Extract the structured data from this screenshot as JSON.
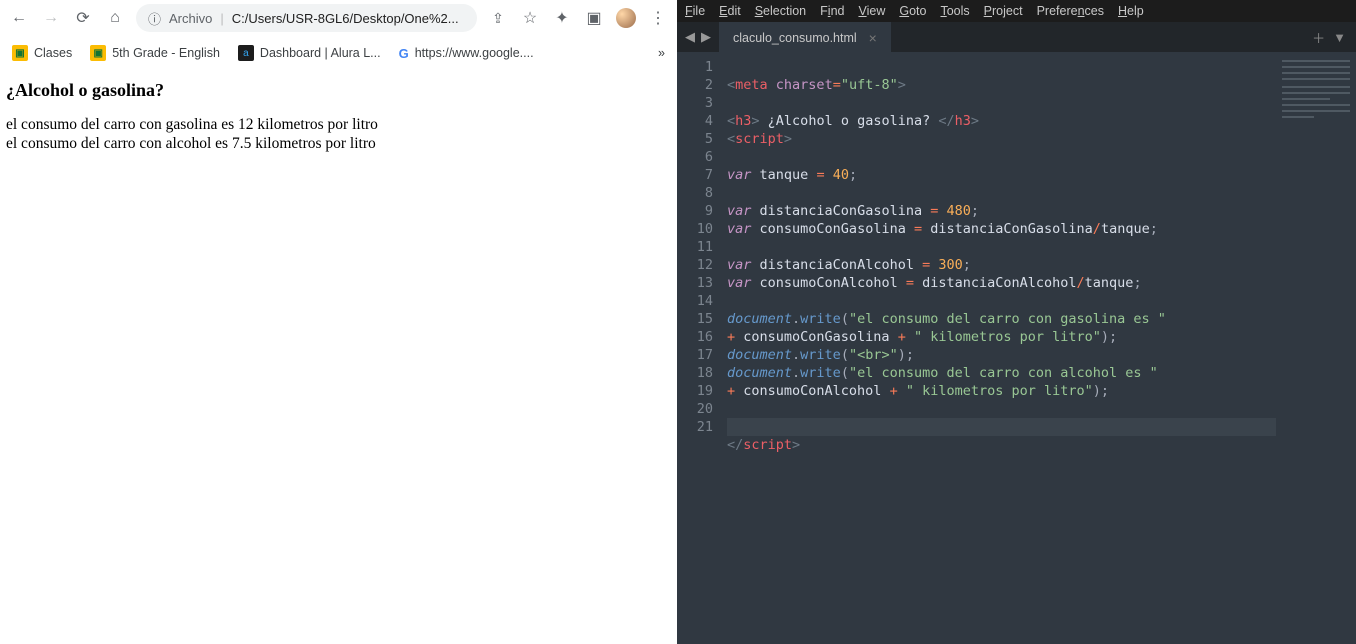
{
  "browser": {
    "address_label": "Archivo",
    "address_path": "C:/Users/USR-8GL6/Desktop/One%2...",
    "bookmarks": [
      "Clases",
      "5th Grade - English",
      "Dashboard | Alura L...",
      "https://www.google...."
    ],
    "page": {
      "heading": "¿Alcohol o gasolina?",
      "line1": "el consumo del carro con gasolina es 12 kilometros por litro",
      "line2": "el consumo del carro con alcohol es 7.5 kilometros por litro"
    }
  },
  "editor": {
    "menus": [
      "File",
      "Edit",
      "Selection",
      "Find",
      "View",
      "Goto",
      "Tools",
      "Project",
      "Preferences",
      "Help"
    ],
    "tab_title": "claculo_consumo.html",
    "line_count": 21,
    "current_line": 20,
    "code": {
      "l1": {
        "a": "<",
        "b": "meta",
        "c": " ",
        "d": "charset",
        "e": "=",
        "f": "\"uft-8\"",
        "g": ">"
      },
      "l3": {
        "open_a": "<",
        "open_tag": "h3",
        "open_b": ">",
        "text": " ¿Alcohol o gasolina? ",
        "close_a": "</",
        "close_tag": "h3",
        "close_b": ">"
      },
      "l4": {
        "a": "<",
        "b": "script",
        "c": ">"
      },
      "l6": {
        "kw": "var",
        "sp": " ",
        "id": "tanque",
        "eq": " = ",
        "num": "40",
        "semi": ";"
      },
      "l8": {
        "kw": "var",
        "sp": " ",
        "id": "distanciaConGasolina",
        "eq": " = ",
        "num": "480",
        "semi": ";"
      },
      "l9": {
        "kw": "var",
        "sp": " ",
        "id": "consumoConGasolina",
        "eq": " = ",
        "rhs_a": "distanciaConGasolina",
        "slash": "/",
        "rhs_b": "tanque",
        "semi": ";"
      },
      "l11": {
        "kw": "var",
        "sp": " ",
        "id": "distanciaConAlcohol",
        "eq": " = ",
        "num": "300",
        "semi": ";"
      },
      "l12": {
        "kw": "var",
        "sp": " ",
        "id": "consumoConAlcohol",
        "eq": " = ",
        "rhs_a": "distanciaConAlcohol",
        "slash": "/",
        "rhs_b": "tanque",
        "semi": ";"
      },
      "l14": {
        "obj": "document",
        "dot": ".",
        "fn": "write",
        "paren": "(",
        "str": "\"el consumo del carro con gasolina es \""
      },
      "l15": {
        "plus": "+ ",
        "id": "consumoConGasolina",
        "plus2": " + ",
        "str": "\" kilometros por litro\"",
        "close": ");"
      },
      "l16": {
        "obj": "document",
        "dot": ".",
        "fn": "write",
        "paren": "(",
        "str": "\"<br>\"",
        "close": ");"
      },
      "l17": {
        "obj": "document",
        "dot": ".",
        "fn": "write",
        "paren": "(",
        "str": "\"el consumo del carro con alcohol es \""
      },
      "l18": {
        "plus": "+ ",
        "id": "consumoConAlcohol",
        "plus2": " + ",
        "str": "\" kilometros por litro\"",
        "close": ");"
      },
      "l21": {
        "a": "</",
        "b": "script",
        "c": ">"
      }
    }
  }
}
